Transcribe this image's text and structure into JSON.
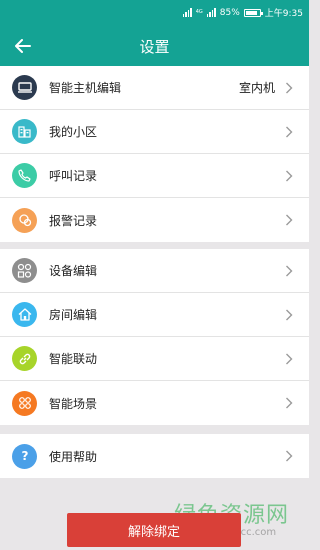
{
  "status_bar": {
    "network_label": "4G",
    "battery_percent_text": "85%",
    "battery_level": 0.85,
    "time": "上午9:35"
  },
  "header": {
    "title": "设置",
    "back_icon": "arrow-left-icon",
    "color": "#14a394"
  },
  "groups": [
    {
      "items": [
        {
          "label": "智能主机编辑",
          "value": "室内机",
          "icon": "monitor-icon",
          "icon_color": "#2b3a4f"
        },
        {
          "label": "我的小区",
          "icon": "building-icon",
          "icon_color": "#39b9c9"
        },
        {
          "label": "呼叫记录",
          "icon": "phone-icon",
          "icon_color": "#3ccca6"
        },
        {
          "label": "报警记录",
          "icon": "alarm-icon",
          "icon_color": "#f5a156"
        }
      ]
    },
    {
      "items": [
        {
          "label": "设备编辑",
          "icon": "devices-icon",
          "icon_color": "#8e8e8e"
        },
        {
          "label": "房间编辑",
          "icon": "home-icon",
          "icon_color": "#3ab7ee"
        },
        {
          "label": "智能联动",
          "icon": "link-icon",
          "icon_color": "#a7d42a"
        },
        {
          "label": "智能场景",
          "icon": "scene-icon",
          "icon_color": "#f57922"
        }
      ]
    },
    {
      "items": [
        {
          "label": "使用帮助",
          "icon": "help-icon",
          "icon_color": "#4ba0e8"
        }
      ]
    }
  ],
  "unbind_button": {
    "label": "解除绑定",
    "color": "#d94038"
  },
  "watermark": {
    "title": "绿色资源网",
    "url": "www.downcc.com"
  }
}
